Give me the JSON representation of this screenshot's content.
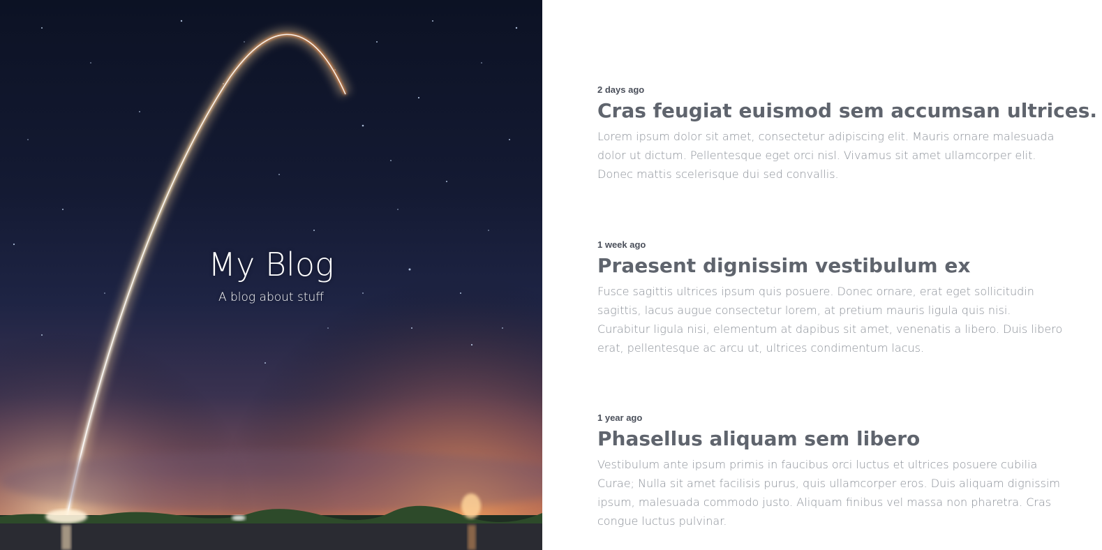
{
  "hero": {
    "title": "My Blog",
    "subtitle": "A blog about stuff"
  },
  "posts": [
    {
      "date": "2 days ago",
      "title": "Cras feugiat euismod sem accumsan ultrices.",
      "body": "Lorem ipsum dolor sit amet, consectetur adipiscing elit. Mauris ornare malesuada dolor ut dictum. Pellentesque eget orci nisl. Vivamus sit amet ullamcorper elit. Donec mattis scelerisque dui sed convallis."
    },
    {
      "date": "1 week ago",
      "title": "Praesent dignissim vestibulum ex",
      "body": "Fusce sagittis ultrices ipsum quis posuere. Donec ornare, erat eget sollicitudin sagittis, lacus augue consectetur lorem, at pretium mauris ligula quis nisi. Curabitur ligula nisi, elementum at dapibus sit amet, venenatis a libero. Duis libero erat, pellentesque ac arcu ut, ultrices condimentum lacus."
    },
    {
      "date": "1 year ago",
      "title": "Phasellus aliquam sem libero",
      "body": "Vestibulum ante ipsum primis in faucibus orci luctus et ultrices posuere cubilia Curae; Nulla sit amet facilisis purus, quis ullamcorper eros. Duis aliquam dignissim ipsum, malesuada commodo justo. Aliquam finibus vel massa non pharetra. Cras congue luctus pulvinar."
    }
  ],
  "colors": {
    "post_title": "#5f646d",
    "post_date": "#4a4f5a",
    "post_body": "#8a8f97",
    "hero_text": "#ffffff"
  }
}
